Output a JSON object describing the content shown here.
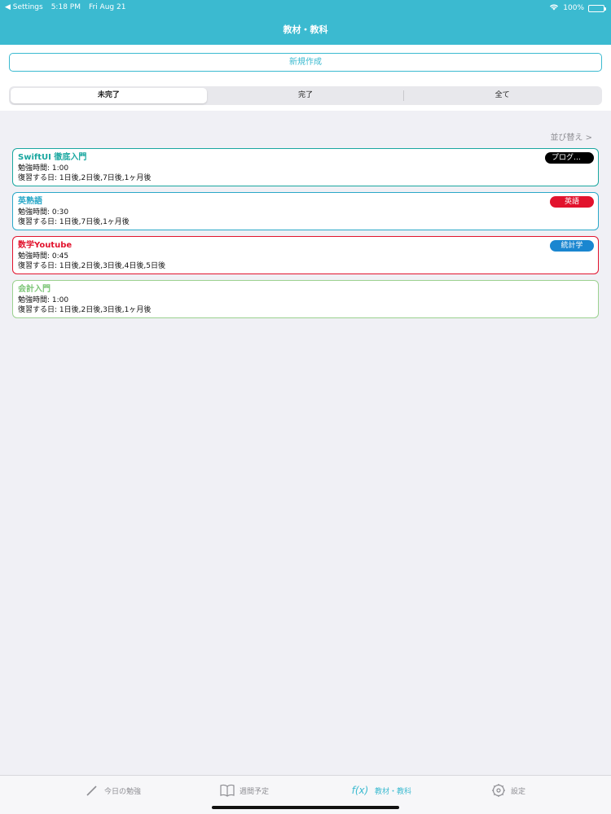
{
  "status": {
    "back_label": "◀ Settings",
    "time": "5:18 PM",
    "date": "Fri Aug 21",
    "battery": "100%"
  },
  "nav": {
    "title": "教材・教科"
  },
  "new_button": {
    "label": "新規作成"
  },
  "segments": [
    {
      "label": "未完了",
      "active": true
    },
    {
      "label": "完了",
      "active": false
    },
    {
      "label": "全て",
      "active": false
    }
  ],
  "sort": {
    "label": "並び替え >"
  },
  "items": [
    {
      "title": "SwiftUI 徹底入門",
      "title_color": "#1aa7a0",
      "border_color": "#1aa7a0",
      "study_time": "勉強時間: 1:00",
      "review": "復習する日: 1日後,2日後,7日後,1ヶ月後",
      "tag": "プログラミング",
      "tag_color": "#000000"
    },
    {
      "title": "英熟語",
      "title_color": "#2aa8c8",
      "border_color": "#2aa8c8",
      "study_time": "勉強時間: 0:30",
      "review": "復習する日: 1日後,7日後,1ヶ月後",
      "tag": "英語",
      "tag_color": "#e2132d"
    },
    {
      "title": "数学Youtube",
      "title_color": "#e2132d",
      "border_color": "#e2132d",
      "study_time": "勉強時間: 0:45",
      "review": "復習する日: 1日後,2日後,3日後,4日後,5日後",
      "tag": "統計学",
      "tag_color": "#1a86d0"
    },
    {
      "title": "会計入門",
      "title_color": "#7cc576",
      "border_color": "#9bd18f",
      "study_time": "勉強時間: 1:00",
      "review": "復習する日: 1日後,2日後,3日後,1ヶ月後",
      "tag": "",
      "tag_color": ""
    }
  ],
  "tabs": [
    {
      "label": "今日の勉強",
      "icon": "pencil-icon"
    },
    {
      "label": "週間予定",
      "icon": "book-icon"
    },
    {
      "label": "教材・教科",
      "icon": "function-icon",
      "glyph": "f(x)"
    },
    {
      "label": "設定",
      "icon": "gear-icon"
    }
  ],
  "colors": {
    "accent": "#3bbad0"
  }
}
